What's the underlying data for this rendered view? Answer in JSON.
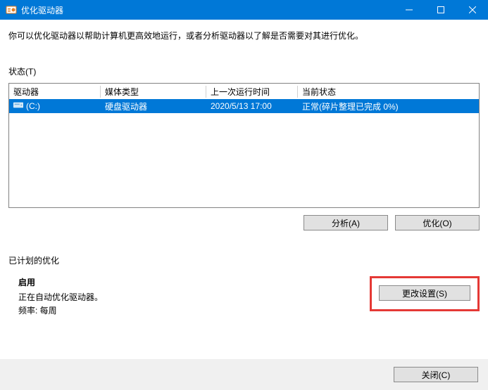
{
  "window": {
    "title": "优化驱动器"
  },
  "description": "你可以优化驱动器以帮助计算机更高效地运行，或者分析驱动器以了解是否需要对其进行优化。",
  "status_label": "状态(T)",
  "columns": {
    "drive": "驱动器",
    "media": "媒体类型",
    "last": "上一次运行时间",
    "status": "当前状态"
  },
  "row": {
    "drive": "(C:)",
    "media": "硬盘驱动器",
    "last": "2020/5/13 17:00",
    "status": "正常(碎片整理已完成 0%)"
  },
  "buttons": {
    "analyze": "分析(A)",
    "optimize": "优化(O)",
    "change_settings": "更改设置(S)",
    "close": "关闭(C)"
  },
  "scheduled": {
    "title": "已计划的优化",
    "on": "启用",
    "desc": "正在自动优化驱动器。",
    "freq": "频率: 每周"
  }
}
